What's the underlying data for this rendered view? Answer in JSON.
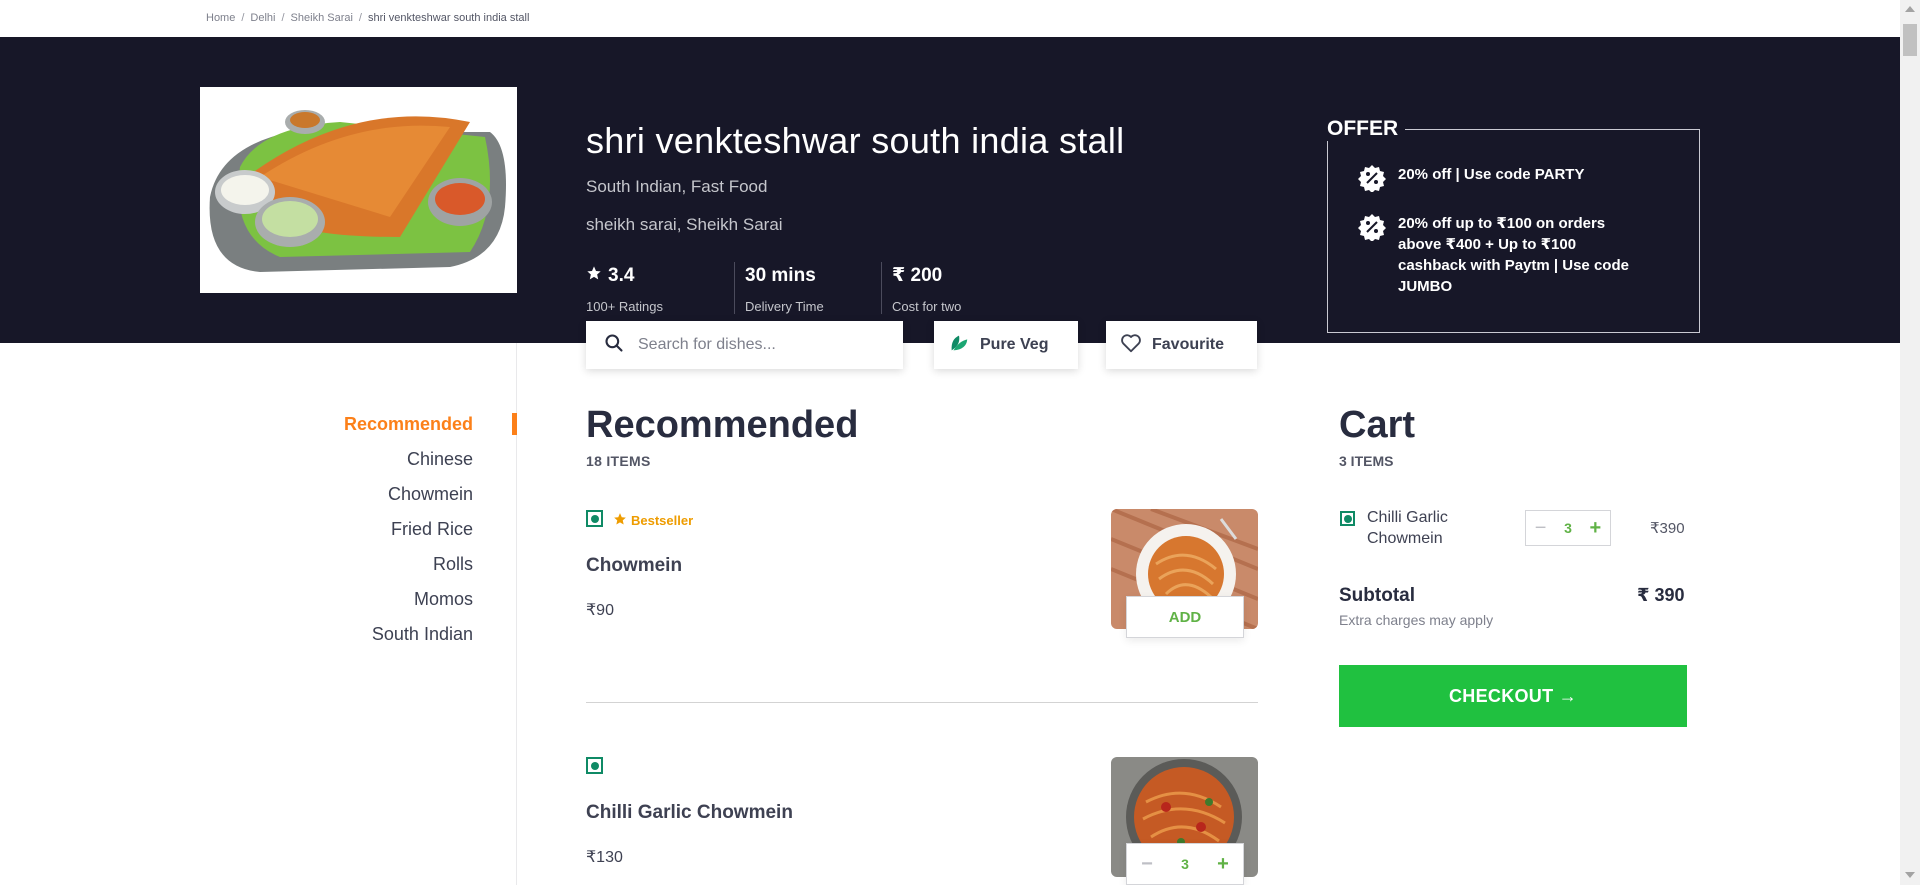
{
  "breadcrumb": [
    "Home",
    "Delhi",
    "Sheikh Sarai",
    "shri venkteshwar south india stall"
  ],
  "restaurant": {
    "name": "shri venkteshwar south india stall",
    "cuisines": "South Indian, Fast Food",
    "locality": "sheikh sarai, Sheikh Sarai",
    "rating": "3.4",
    "rating_label": "100+ Ratings",
    "delivery_time": "30 mins",
    "delivery_label": "Delivery Time",
    "cost": "₹ 200",
    "cost_label": "Cost for two"
  },
  "offer": {
    "title": "OFFER",
    "items": [
      "20% off | Use code PARTY",
      "20% off up to ₹100 on orders above ₹400 + Up to ₹100 cashback with Paytm | Use code JUMBO"
    ]
  },
  "search": {
    "placeholder": "Search for dishes..."
  },
  "filters": {
    "veg_label": "Pure Veg",
    "fav_label": "Favourite"
  },
  "categories": [
    "Recommended",
    "Chinese",
    "Chowmein",
    "Fried Rice",
    "Rolls",
    "Momos",
    "South Indian"
  ],
  "menu": {
    "section_title": "Recommended",
    "section_count": "18 ITEMS",
    "items": [
      {
        "badge": "Bestseller",
        "name": "Chowmein",
        "price": "₹90",
        "action": "ADD"
      },
      {
        "name": "Chilli Garlic Chowmein",
        "price": "₹130",
        "qty": "3",
        "minus": "−",
        "plus": "+"
      }
    ]
  },
  "cart": {
    "title": "Cart",
    "count": "3 ITEMS",
    "items": [
      {
        "name": "Chilli Garlic Chowmein",
        "qty": "3",
        "price": "₹390",
        "minus": "−",
        "plus": "+"
      }
    ],
    "subtotal_label": "Subtotal",
    "subtotal_value": "₹ 390",
    "extra_note": "Extra charges may apply",
    "checkout_label": "CHECKOUT →"
  },
  "colors": {
    "header_bg": "#171728",
    "accent": "#fc8019",
    "veg": "#0f8a65",
    "add_green": "#60b246",
    "checkout": "#20c140"
  },
  "icons": [
    "star-icon",
    "search-icon",
    "leaf-icon",
    "heart-icon",
    "discount-badge-icon",
    "veg-icon",
    "bestseller-star-icon"
  ]
}
